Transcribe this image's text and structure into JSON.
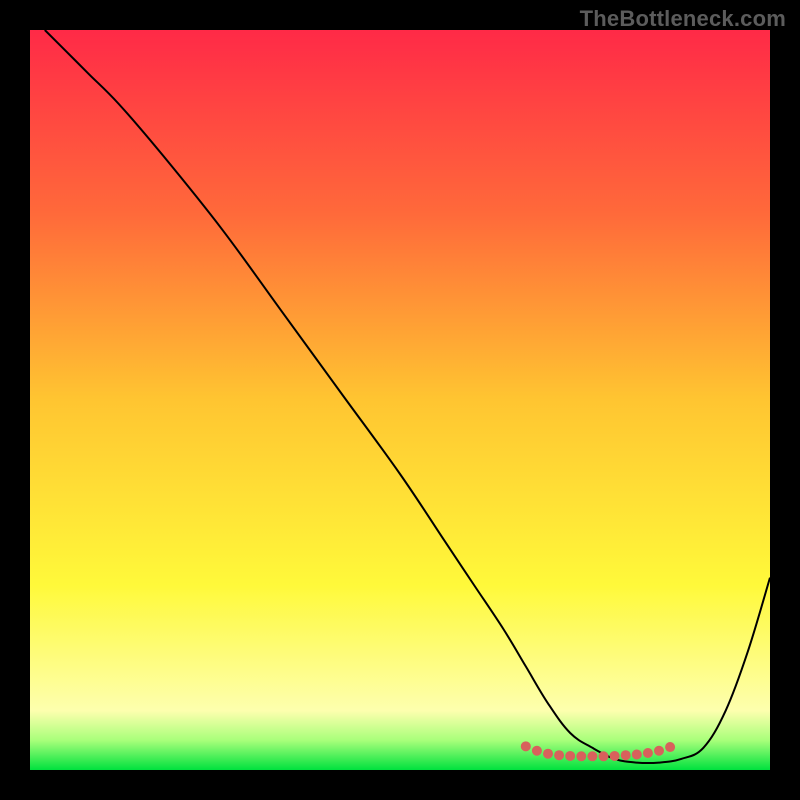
{
  "watermark": "TheBottleneck.com",
  "chart_data": {
    "type": "line",
    "title": "",
    "xlabel": "",
    "ylabel": "",
    "xlim": [
      0,
      100
    ],
    "ylim": [
      0,
      100
    ],
    "grid": false,
    "legend": false,
    "annotations": [],
    "background_gradient": {
      "stops": [
        {
          "offset": 0,
          "color": "#ff2a47"
        },
        {
          "offset": 25,
          "color": "#ff6a3a"
        },
        {
          "offset": 50,
          "color": "#ffc531"
        },
        {
          "offset": 75,
          "color": "#fff93a"
        },
        {
          "offset": 92,
          "color": "#fdffae"
        },
        {
          "offset": 96,
          "color": "#a8ff7a"
        },
        {
          "offset": 100,
          "color": "#00e23e"
        }
      ]
    },
    "series": [
      {
        "name": "bottleneck-curve",
        "color": "#000000",
        "width": 2,
        "x": [
          2,
          5,
          8,
          12,
          18,
          26,
          34,
          42,
          50,
          56,
          60,
          64,
          67,
          70,
          73,
          76,
          79,
          82,
          85,
          88,
          91,
          94,
          97,
          100
        ],
        "y": [
          100,
          97,
          94,
          90,
          83,
          73,
          62,
          51,
          40,
          31,
          25,
          19,
          14,
          9,
          5,
          3,
          1.5,
          1,
          1,
          1.5,
          3,
          8,
          16,
          26
        ]
      }
    ],
    "markers": {
      "name": "sweet-spot-dots",
      "color": "#d8615c",
      "radius": 5,
      "points": [
        {
          "x": 67,
          "y": 3.2
        },
        {
          "x": 68.5,
          "y": 2.6
        },
        {
          "x": 70,
          "y": 2.2
        },
        {
          "x": 71.5,
          "y": 2.0
        },
        {
          "x": 73,
          "y": 1.9
        },
        {
          "x": 74.5,
          "y": 1.85
        },
        {
          "x": 76,
          "y": 1.85
        },
        {
          "x": 77.5,
          "y": 1.85
        },
        {
          "x": 79,
          "y": 1.9
        },
        {
          "x": 80.5,
          "y": 2.0
        },
        {
          "x": 82,
          "y": 2.1
        },
        {
          "x": 83.5,
          "y": 2.3
        },
        {
          "x": 85,
          "y": 2.6
        },
        {
          "x": 86.5,
          "y": 3.1
        }
      ]
    }
  }
}
